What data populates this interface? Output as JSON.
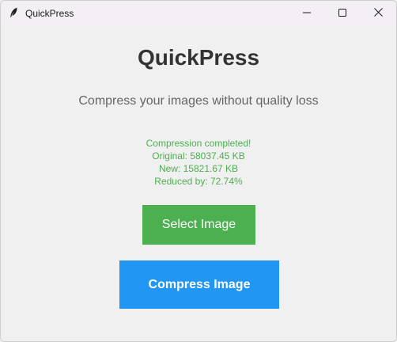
{
  "window": {
    "title": "QuickPress",
    "icon": "feather-icon",
    "controls": [
      "minimize-icon",
      "maximize-icon",
      "close-icon"
    ]
  },
  "main": {
    "heading": "QuickPress",
    "subtitle": "Compress your images without quality loss",
    "status": {
      "line1": "Compression completed!",
      "line2": "Original: 58037.45 KB",
      "line3": "New: 15821.67 KB",
      "line4": "Reduced by: 72.74%"
    },
    "select_button": "Select Image",
    "compress_button": "Compress Image"
  },
  "colors": {
    "status_text": "#4caf50",
    "select_button_bg": "#4caf50",
    "compress_button_bg": "#2196f3",
    "heading_text": "#333333",
    "subtitle_text": "#666666"
  }
}
